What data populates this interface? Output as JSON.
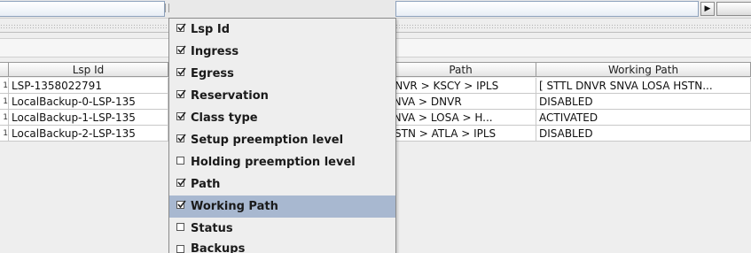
{
  "table": {
    "columns": {
      "lsp_id": "Lsp Id",
      "path": "Path",
      "working_path": "Working Path"
    },
    "rows": [
      {
        "lsp_id": "LSP-1358022791",
        "path": "DNVR > KSCY > IPLS",
        "working_path": "[ STTL DNVR SNVA LOSA HSTN..."
      },
      {
        "lsp_id": "LocalBackup-0-LSP-135",
        "path": "SNVA > DNVR",
        "working_path": "DISABLED"
      },
      {
        "lsp_id": "LocalBackup-1-LSP-135",
        "path": "SNVA > LOSA > H...",
        "working_path": "ACTIVATED"
      },
      {
        "lsp_id": "LocalBackup-2-LSP-135",
        "path": "HSTN > ATLA > IPLS",
        "working_path": "DISABLED"
      }
    ]
  },
  "menu": {
    "items": [
      {
        "label": "Lsp Id",
        "checked": true
      },
      {
        "label": "Ingress",
        "checked": true
      },
      {
        "label": "Egress",
        "checked": true
      },
      {
        "label": "Reservation",
        "checked": true
      },
      {
        "label": "Class type",
        "checked": true
      },
      {
        "label": "Setup preemption level",
        "checked": true
      },
      {
        "label": "Holding preemption level",
        "checked": false
      },
      {
        "label": "Path",
        "checked": true
      },
      {
        "label": "Working Path",
        "checked": true,
        "highlighted": true
      },
      {
        "label": "Status",
        "checked": false
      },
      {
        "label": "Backups",
        "checked": false
      }
    ]
  },
  "colors": {
    "menu_highlight": "#a8b8d0",
    "menu_background": "#eeeeee"
  }
}
